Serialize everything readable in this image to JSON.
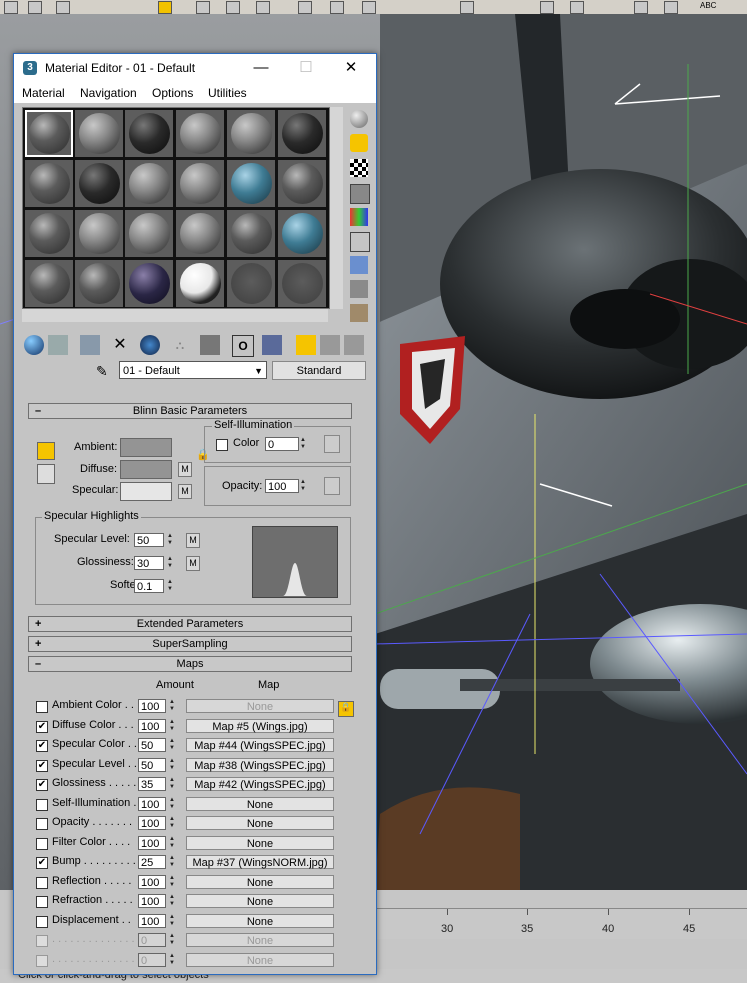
{
  "window": {
    "title": "Material Editor - 01 - Default",
    "minimize": "—",
    "maximize": "☐",
    "close": "✕"
  },
  "menu": [
    "Material",
    "Navigation",
    "Options",
    "Utilities"
  ],
  "material_name": "01 - Default",
  "material_type": "Standard",
  "rollouts": {
    "blinn_basic": "Blinn Basic Parameters",
    "extended": "Extended Parameters",
    "supersampling": "SuperSampling",
    "maps": "Maps",
    "minus": "–",
    "plus": "+"
  },
  "blinn": {
    "ambient_label": "Ambient:",
    "diffuse_label": "Diffuse:",
    "specular_label": "Specular:",
    "m": "M",
    "self_illum_title": "Self-Illumination",
    "color_label": "Color",
    "self_illum_value": "0",
    "opacity_label": "Opacity:",
    "opacity_value": "100",
    "colors": {
      "ambient": "#949494",
      "diffuse": "#949494",
      "specular": "#e6e6e6"
    }
  },
  "specular_highlights": {
    "title": "Specular Highlights",
    "level_label": "Specular Level:",
    "level_value": "50",
    "gloss_label": "Glossiness:",
    "gloss_value": "30",
    "soften_label": "Soften:",
    "soften_value": "0.1"
  },
  "maps_header": {
    "amount": "Amount",
    "map": "Map"
  },
  "maps": [
    {
      "label": "Ambient Color . . .",
      "checked": false,
      "amount": "100",
      "map": "None",
      "disabled_map": true,
      "disabled": false
    },
    {
      "label": "Diffuse Color . . .",
      "checked": true,
      "amount": "100",
      "map": "Map #5 (Wings.jpg)",
      "disabled_map": false,
      "disabled": false
    },
    {
      "label": "Specular Color . .",
      "checked": true,
      "amount": "50",
      "map": "Map #44 (WingsSPEC.jpg)",
      "disabled_map": false,
      "disabled": false
    },
    {
      "label": "Specular Level . .",
      "checked": true,
      "amount": "50",
      "map": "Map #38 (WingsSPEC.jpg)",
      "disabled_map": false,
      "disabled": false
    },
    {
      "label": "Glossiness . . . . .",
      "checked": true,
      "amount": "35",
      "map": "Map #42 (WingsSPEC.jpg)",
      "disabled_map": false,
      "disabled": false
    },
    {
      "label": "Self-Illumination .",
      "checked": false,
      "amount": "100",
      "map": "None",
      "disabled_map": false,
      "disabled": false
    },
    {
      "label": "Opacity . . . . . . .",
      "checked": false,
      "amount": "100",
      "map": "None",
      "disabled_map": false,
      "disabled": false
    },
    {
      "label": "Filter Color . . . .",
      "checked": false,
      "amount": "100",
      "map": "None",
      "disabled_map": false,
      "disabled": false
    },
    {
      "label": "Bump . . . . . . . . .",
      "checked": true,
      "amount": "25",
      "map": "Map #37 (WingsNORM.jpg)",
      "disabled_map": false,
      "disabled": false
    },
    {
      "label": "Reflection . . . . .",
      "checked": false,
      "amount": "100",
      "map": "None",
      "disabled_map": false,
      "disabled": false
    },
    {
      "label": "Refraction . . . . .",
      "checked": false,
      "amount": "100",
      "map": "None",
      "disabled_map": false,
      "disabled": false
    },
    {
      "label": "Displacement . .",
      "checked": false,
      "amount": "100",
      "map": "None",
      "disabled_map": false,
      "disabled": false
    },
    {
      "label": ". . . . . . . . . . . . . .",
      "checked": false,
      "amount": "0",
      "map": "None",
      "disabled_map": true,
      "disabled": true
    },
    {
      "label": ". . . . . . . . . . . . . .",
      "checked": false,
      "amount": "0",
      "map": "None",
      "disabled_map": true,
      "disabled": true
    }
  ],
  "timeline": {
    "ticks": [
      "30",
      "35",
      "40",
      "45"
    ]
  },
  "status": "Click or click-and-drag to select objects",
  "toolbar_labels": {
    "abc": "ABC"
  }
}
